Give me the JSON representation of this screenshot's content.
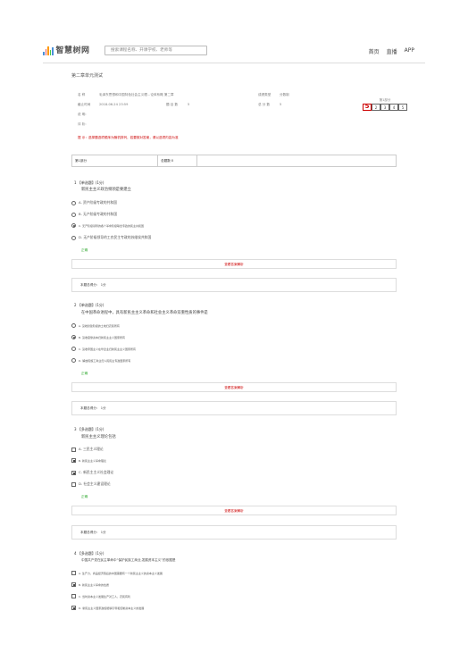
{
  "header": {
    "logo_text": "智慧树网",
    "search_placeholder": "搜索课程名称、开课学校、老师等",
    "nav": [
      "首页",
      "直播",
      "APP"
    ]
  },
  "chapter_title": "第二章单元测试",
  "info": {
    "name_label": "名    称",
    "name_value": "毛泽东思想和中国特色社会主义理...论体系概 第二章",
    "deadline_label": "截止时间",
    "deadline_value": "2018-06-24 23:59",
    "count_label": "题 目 数",
    "count_value": "5",
    "type_label": "成绩类型",
    "type_value": "分数制",
    "total_label": "总 分 数",
    "total_value": "5",
    "desc_label": "说    明:",
    "review_label": "评    析:"
  },
  "score_box": {
    "label": "第1部分",
    "cells": [
      "5",
      "2",
      "3",
      "4",
      "5"
    ]
  },
  "tip": "提    示：选择题选项顺序为随机排列，若要核对答案，请以选项内容为准",
  "section": {
    "part": "第1部分",
    "total": "总题数:5"
  },
  "questions": [
    {
      "head": "1 【单选题】(1分)",
      "stem": "新民主主义政治纲领是要建立",
      "options": [
        "A. 资产阶级专政的共和国",
        "B. 无产阶级专政的共和国",
        "C. 无产阶级领导的各个革命阶级联合专政的民主共和国",
        "D. 无产阶级领导的工农民主专政的苏维埃共和国"
      ],
      "selected": [
        2
      ],
      "status": "正确",
      "answer_label": "查看答案解析",
      "score": "本题总得分：  1分"
    },
    {
      "head": "2 【单选题】(1分)",
      "stem": "在中国革命进程中，具有新民主主义革命和社会主义革命双重性质的事件是",
      "options": [
        "A. 没收封建阶级的土地归农民所有",
        "B. 没收官僚资本归新民主主义国家所有",
        "C. 没收帝国主义在华企业归新民主主义国家所有",
        "D. 解放民族工商业归人民民主专政国家所有"
      ],
      "selected": [
        1
      ],
      "status": "正确",
      "answer_label": "查看答案解析",
      "score": "本题总得分：  1分"
    },
    {
      "head": "3 【多选题】(1分)",
      "stem": "新民主主义理论包括",
      "options": [
        "A. 三民主义理论",
        "B. 新民主主义革命理论",
        "C. 新民主主义社会理论",
        "D. 社会主义建设理论"
      ],
      "selected": [
        1,
        2
      ],
      "status": "正确",
      "answer_label": "查看答案解析",
      "score": "本题总得分：  1分"
    },
    {
      "head": "4 【多选题】(1分)",
      "stem": "中国共产党在民主革命中“保护民族工商业,发展资本主义”的依据是",
      "options": [
        "A. 生产力，商品经济落后的中国需要有一个新民主主义的资本主义发展",
        "B. 新民主主义革命的性质",
        "C. 当时资本主义发展生产对工人，农民有利",
        "D. 新民主主义国家政权能够引导和控制资本主义的发展"
      ],
      "selected": [
        1,
        3
      ]
    }
  ]
}
